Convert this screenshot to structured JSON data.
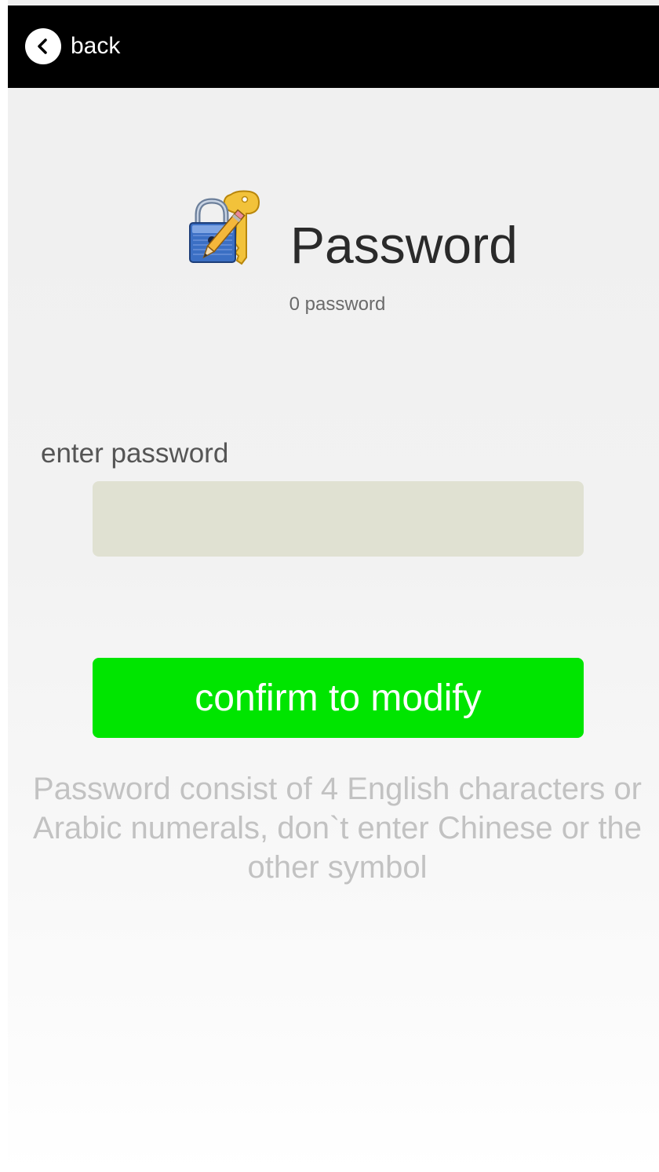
{
  "header": {
    "back_label": "back",
    "back_icon": "chevron-left-icon"
  },
  "main": {
    "logo_icon": "lock-key-pencil-icon",
    "title": "Password",
    "subtitle": "0 password",
    "field_label": "enter password",
    "input_value": "",
    "input_placeholder": "",
    "confirm_label": "confirm to modify",
    "hint_text": "Password consist of 4 English characters or Arabic numerals, don`t enter Chinese or the other symbol"
  },
  "colors": {
    "header_bg": "#000000",
    "confirm_bg": "#00e500",
    "input_bg": "#e0e1d2",
    "hint_text": "#c2c2c2"
  }
}
